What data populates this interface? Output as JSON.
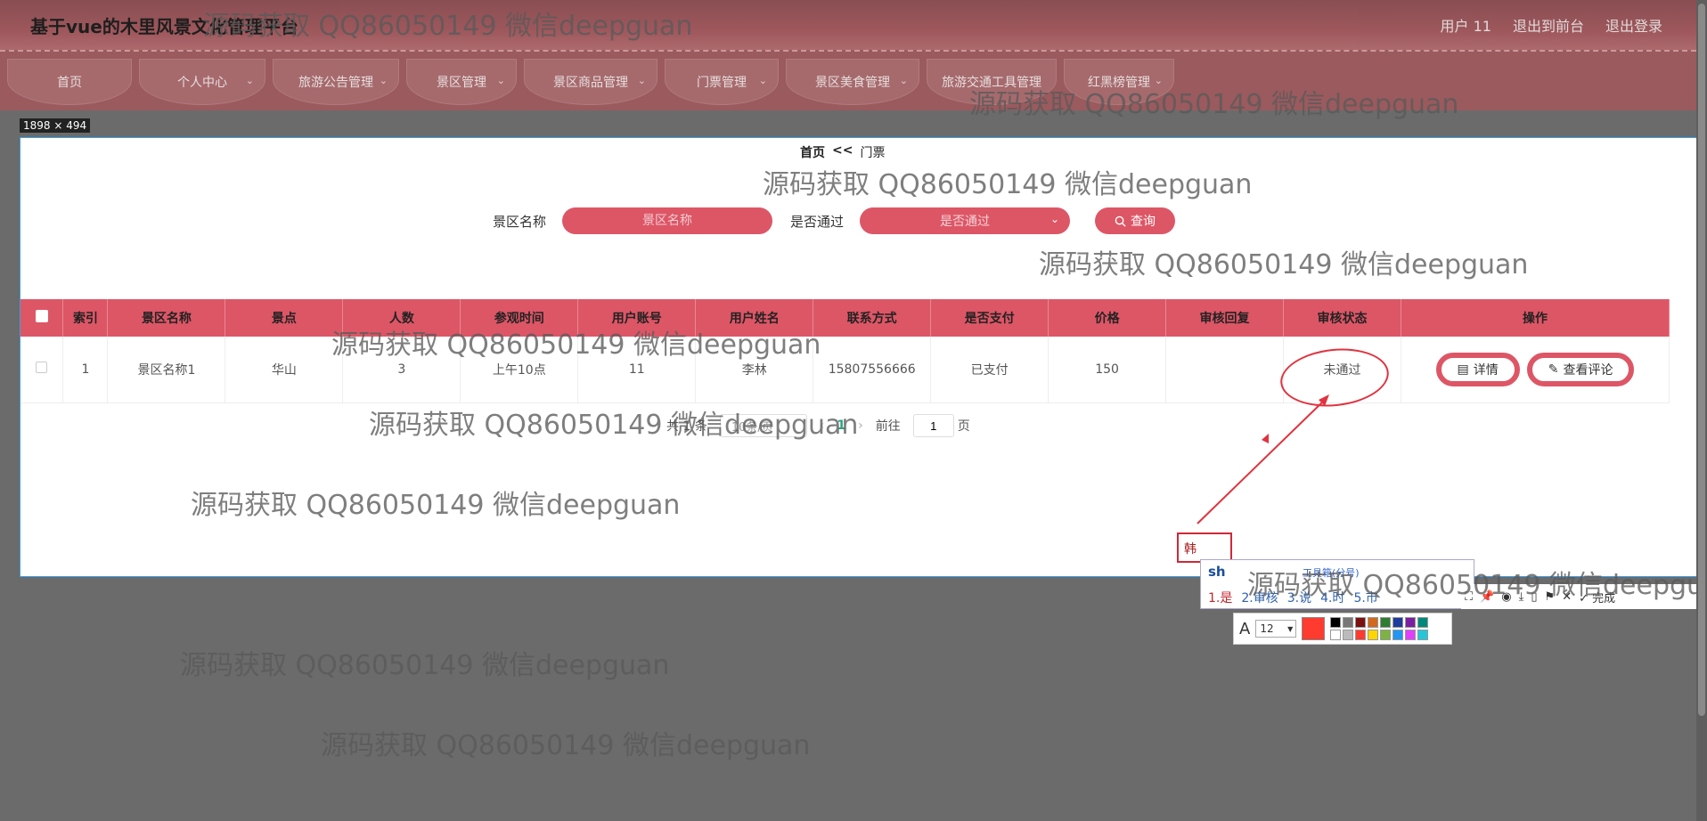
{
  "header": {
    "title": "基于vue的木里风景文化管理平台",
    "links": [
      "用户 11",
      "退出到前台",
      "退出登录"
    ]
  },
  "nav": [
    {
      "label": "首页",
      "has_menu": false
    },
    {
      "label": "个人中心",
      "has_menu": true
    },
    {
      "label": "旅游公告管理",
      "has_menu": true
    },
    {
      "label": "景区管理",
      "has_menu": true
    },
    {
      "label": "景区商品管理",
      "has_menu": true
    },
    {
      "label": "门票管理",
      "has_menu": true
    },
    {
      "label": "景区美食管理",
      "has_menu": true
    },
    {
      "label": "旅游交通工具管理",
      "has_menu": false
    },
    {
      "label": "红黑榜管理",
      "has_menu": true
    }
  ],
  "size_tag": "1898 × 494",
  "breadcrumb": {
    "home": "首页",
    "sep": "<<",
    "current": "门票"
  },
  "search": {
    "name_label": "景区名称",
    "name_placeholder": "景区名称",
    "pass_label": "是否通过",
    "pass_placeholder": "是否通过",
    "query_label": "查询"
  },
  "table": {
    "headers": [
      "索引",
      "景区名称",
      "景点",
      "人数",
      "参观时间",
      "用户账号",
      "用户姓名",
      "联系方式",
      "是否支付",
      "价格",
      "审核回复",
      "审核状态",
      "操作"
    ],
    "rows": [
      {
        "index": "1",
        "scenic_name": "景区名称1",
        "spot": "华山",
        "people": "3",
        "visit_time": "上午10点",
        "account": "11",
        "user_name": "李林",
        "phone": "15807556666",
        "paid": "已支付",
        "price": "150",
        "reply": "",
        "status": "未通过"
      }
    ],
    "actions": {
      "detail": "详情",
      "comments": "查看评论"
    }
  },
  "pagination": {
    "total_label": "共 1 条",
    "page_size": "10条/页",
    "current_page": "1",
    "jump_prefix": "前往",
    "jump_value": "1",
    "jump_suffix": "页"
  },
  "annotation": {
    "box_text": "韩",
    "ime_code": "sh",
    "ime_hint": "工具箱(分号)",
    "candidates": [
      "1.是",
      "2.审核",
      "3.说",
      "4.时",
      "5.市"
    ],
    "font_size": "12",
    "toolbar_done": "完成"
  },
  "colors": {
    "accent": "#dd5666",
    "annotation_red": "#e0333f",
    "header_bg": "#9b5a5e"
  },
  "watermark": "源码获取 QQ86050149 微信deepguan"
}
